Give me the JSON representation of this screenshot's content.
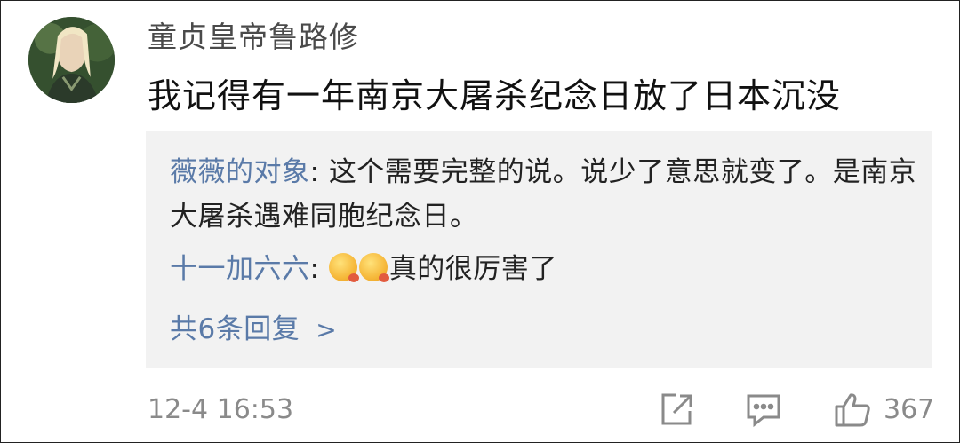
{
  "comment": {
    "avatar_icon": "user-avatar",
    "username": "童贞皇帝鲁路修",
    "text": "我记得有一年南京大屠杀纪念日放了日本沉没",
    "timestamp": "12-4 16:53",
    "likes": "367"
  },
  "replies": [
    {
      "name": "薇薇的对象",
      "separator": ": ",
      "text": "这个需要完整的说。说少了意思就变了。是南京大屠杀遇难同胞纪念日。"
    },
    {
      "name": "十一加六六",
      "separator": ": ",
      "emojis": [
        "yummy-emoji",
        "yummy-emoji"
      ],
      "text": "真的很厉害了"
    }
  ],
  "more_replies": {
    "label": "共6条回复",
    "chevron": ">"
  },
  "actions": {
    "share_icon": "share-icon",
    "comment_icon": "comment-icon",
    "like_icon": "thumbs-up-icon"
  },
  "colors": {
    "reply_name": "#5a7aa8",
    "reply_bg": "#f2f2f2",
    "meta": "#8a8a8a"
  }
}
